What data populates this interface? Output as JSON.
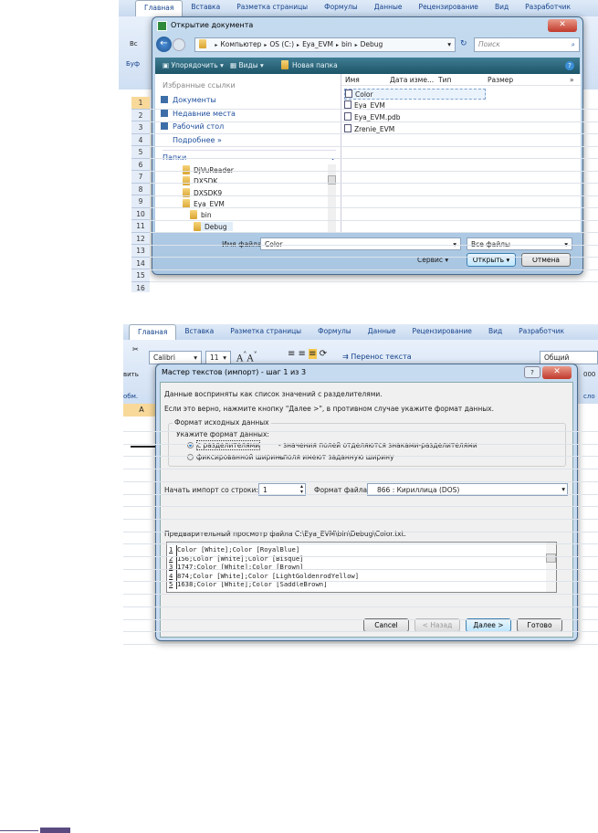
{
  "ribbon_tabs": [
    "Главная",
    "Вставка",
    "Разметка страницы",
    "Формулы",
    "Данные",
    "Рецензирование",
    "Вид",
    "Разработчик"
  ],
  "open_dialog": {
    "title": "Открытие документа",
    "path": [
      "Компьютер",
      "OS (C:)",
      "Eya_EVM",
      "bin",
      "Debug"
    ],
    "search_placeholder": "Поиск",
    "toolbar": {
      "organize": "Упорядочить",
      "views": "Виды",
      "new_folder": "Новая папка"
    },
    "favorites_header": "Избранные ссылки",
    "favorites": [
      "Документы",
      "Недавние места",
      "Рабочий стол"
    ],
    "more": "Подробнее »",
    "folders_header": "Папки",
    "folders": [
      "DjVuReader",
      "DXSDK",
      "DXSDK9",
      "Eya_EVM",
      "bin",
      "Debug"
    ],
    "columns": [
      "Имя",
      "Дата изме...",
      "Тип",
      "Размер",
      "»"
    ],
    "files": [
      "Color",
      "Eya_EVM",
      "Eya_EVM.pdb",
      "Zrenie_EVM"
    ],
    "filename_label": "Имя файла:",
    "filename_value": "Color",
    "filetype": "Все файлы",
    "service": "Сервис",
    "open_btn": "Открыть",
    "cancel_btn": "Отмена",
    "bg_labels": {
      "vs": "Вс",
      "buf": "Буф"
    },
    "row_numbers": [
      "1",
      "2",
      "3",
      "4",
      "5",
      "6",
      "7",
      "8",
      "9",
      "10",
      "11",
      "12",
      "13",
      "14",
      "15",
      "16"
    ]
  },
  "wizard": {
    "ribbon": {
      "font": "Calibri",
      "size": "11",
      "wrap": "Перенос текста",
      "format": "Общий",
      "paste": "вить",
      "clip": "обм.",
      "num": "000",
      "chislo": "сло",
      "col_a": "A"
    },
    "title": "Мастер текстов (импорт) - шаг 1 из 3",
    "help": "?",
    "line1": "Данные восприняты как список значений с разделителями.",
    "line2": "Если это верно, нажмите кнопку \"Далее >\", в противном случае укажите формат данных.",
    "group_title": "Формат исходных данных",
    "format_prompt": "Укажите формат данных:",
    "opt1": "с разделителями",
    "opt1_desc": "- значения полей отделяются знаками-разделителями",
    "opt2": "фиксированной ширины",
    "opt2_desc": "- поля имеют заданную ширину",
    "start_label": "Начать импорт со строки:",
    "start_value": "1",
    "encoding_label": "Формат файла:",
    "encoding_value": "866 : Кириллица (DOS)",
    "preview_label": "Предварительный просмотр файла C:\\Eya_EVM\\bin\\Debug\\Color.txt.",
    "preview_lines": [
      {
        "n": "1",
        "t": "Color [White];Color [RoyalBlue]"
      },
      {
        "n": "2",
        "t": "156;Color [White];Color [Bisque]"
      },
      {
        "n": "3",
        "t": "1747;Color [White];Color [Brown]"
      },
      {
        "n": "4",
        "t": "874;Color [White];Color [LightGoldenrodYellow]"
      },
      {
        "n": "5",
        "t": "1638;Color [White];Color [SaddleBrown]"
      }
    ],
    "cancel": "Cancel",
    "back": "< Назад",
    "next": "Далее >",
    "finish": "Готово"
  }
}
